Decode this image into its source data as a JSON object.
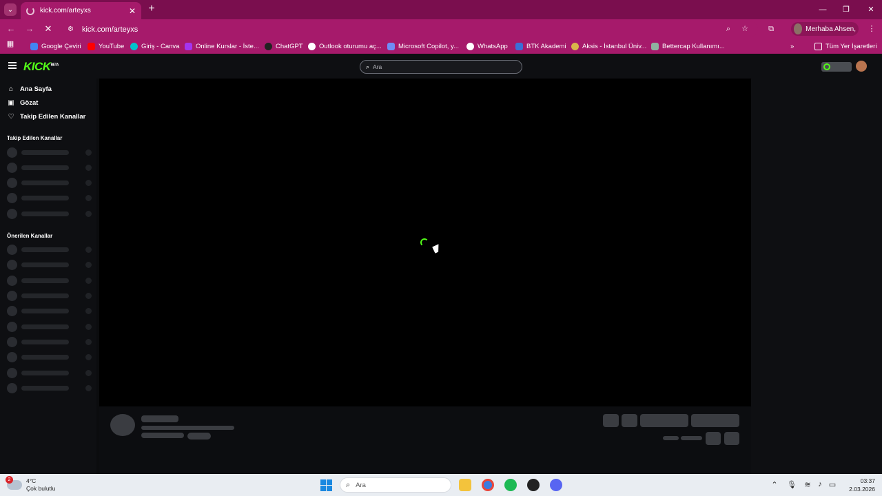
{
  "browser": {
    "tab_title": "kick.com/arteyxs",
    "url": "kick.com/arteyxs",
    "profile_label": "Merhaba Ahsen,",
    "bookmarks": [
      {
        "label": "Google Çeviri",
        "icon": "google-translate-icon",
        "color": "#4285f4"
      },
      {
        "label": "YouTube",
        "icon": "youtube-icon",
        "color": "#ff0000"
      },
      {
        "label": "Giriş - Canva",
        "icon": "canva-icon",
        "color": "#00c4cc"
      },
      {
        "label": "Online Kurslar - İste...",
        "icon": "udemy-icon",
        "color": "#a435f0"
      },
      {
        "label": "ChatGPT",
        "icon": "chatgpt-icon",
        "color": "#222222"
      },
      {
        "label": "Outlook oturumu aç...",
        "icon": "outlook-icon",
        "color": "#ffffff"
      },
      {
        "label": "Microsoft Copilot, y...",
        "icon": "copilot-icon",
        "color": "#6f8cf6"
      },
      {
        "label": "WhatsApp",
        "icon": "whatsapp-icon",
        "color": "#ffffff"
      },
      {
        "label": "BTK Akademi",
        "icon": "btk-icon",
        "color": "#3b6fd8"
      },
      {
        "label": "Aksis - İstanbul Üniv...",
        "icon": "aksis-icon",
        "color": "#d8b64a"
      },
      {
        "label": "Bettercap Kullanımı...",
        "icon": "bettercap-icon",
        "color": "#8fb3a0"
      }
    ],
    "all_bookmarks_label": "Tüm Yer İşaretleri"
  },
  "kick": {
    "logo_text": "KICK",
    "logo_badge": "BETA",
    "search_placeholder": "Ara",
    "nav": [
      {
        "label": "Ana Sayfa",
        "icon": "home-icon"
      },
      {
        "label": "Gözat",
        "icon": "browse-icon"
      },
      {
        "label": "Takip Edilen Kanallar",
        "icon": "heart-icon"
      }
    ],
    "followed_title": "Takip Edilen Kanallar",
    "recommended_title": "Önerilen Kanallar",
    "accent_color": "#53fc18"
  },
  "taskbar": {
    "weather_temp": "4°C",
    "weather_desc": "Çok bulutlu",
    "weather_badge": "2",
    "search_placeholder": "Ara",
    "time": "03:37",
    "date": "2.03.2026"
  }
}
